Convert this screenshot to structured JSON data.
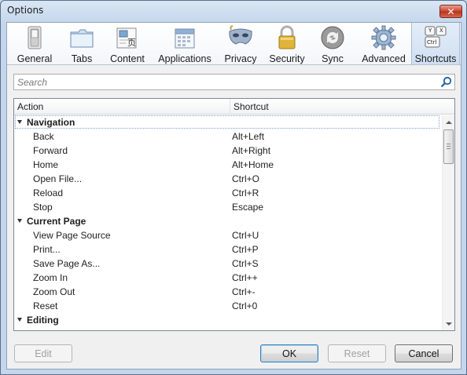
{
  "window": {
    "title": "Options",
    "close_symbol": "✕"
  },
  "panes": [
    {
      "label": "General",
      "icon": "switch-icon",
      "selected": false
    },
    {
      "label": "Tabs",
      "icon": "tabs-folder-icon",
      "selected": false
    },
    {
      "label": "Content",
      "icon": "content-page-icon",
      "selected": false
    },
    {
      "label": "Applications",
      "icon": "applications-calendar-icon",
      "selected": false
    },
    {
      "label": "Privacy",
      "icon": "privacy-mask-icon",
      "selected": false
    },
    {
      "label": "Security",
      "icon": "security-padlock-icon",
      "selected": false
    },
    {
      "label": "Sync",
      "icon": "sync-arrows-icon",
      "selected": false
    },
    {
      "label": "Advanced",
      "icon": "gear-icon",
      "selected": false
    },
    {
      "label": "Shortcuts",
      "icon": "keyboard-keys-icon",
      "selected": true
    }
  ],
  "shortcuts_icon": {
    "key1": "Y",
    "key2": "Ctrl",
    "key3": "X"
  },
  "content_icon": {
    "glyph": "页"
  },
  "search": {
    "placeholder": "Search",
    "value": ""
  },
  "tree": {
    "columns": {
      "action": "Action",
      "shortcut": "Shortcut"
    },
    "rows": [
      {
        "type": "group",
        "action": "Navigation",
        "shortcut": ""
      },
      {
        "type": "item",
        "action": "Back",
        "shortcut": "Alt+Left"
      },
      {
        "type": "item",
        "action": "Forward",
        "shortcut": "Alt+Right"
      },
      {
        "type": "item",
        "action": "Home",
        "shortcut": "Alt+Home"
      },
      {
        "type": "item",
        "action": "Open File...",
        "shortcut": "Ctrl+O"
      },
      {
        "type": "item",
        "action": "Reload",
        "shortcut": "Ctrl+R"
      },
      {
        "type": "item",
        "action": "Stop",
        "shortcut": "Escape"
      },
      {
        "type": "group",
        "action": "Current Page",
        "shortcut": ""
      },
      {
        "type": "item",
        "action": "View Page Source",
        "shortcut": "Ctrl+U"
      },
      {
        "type": "item",
        "action": "Print...",
        "shortcut": "Ctrl+P"
      },
      {
        "type": "item",
        "action": "Save Page As...",
        "shortcut": "Ctrl+S"
      },
      {
        "type": "item",
        "action": "Zoom In",
        "shortcut": "Ctrl++"
      },
      {
        "type": "item",
        "action": "Zoom Out",
        "shortcut": "Ctrl+-"
      },
      {
        "type": "item",
        "action": "Reset",
        "shortcut": "Ctrl+0"
      },
      {
        "type": "group",
        "action": "Editing",
        "shortcut": ""
      }
    ]
  },
  "buttons": {
    "edit": {
      "label": "Edit",
      "enabled": false
    },
    "ok": {
      "label": "OK",
      "enabled": true
    },
    "reset": {
      "label": "Reset",
      "enabled": false
    },
    "cancel": {
      "label": "Cancel",
      "enabled": true
    }
  },
  "colors": {
    "selected_pane": "#cfdff2",
    "window_frame": "#c4d6ec"
  }
}
